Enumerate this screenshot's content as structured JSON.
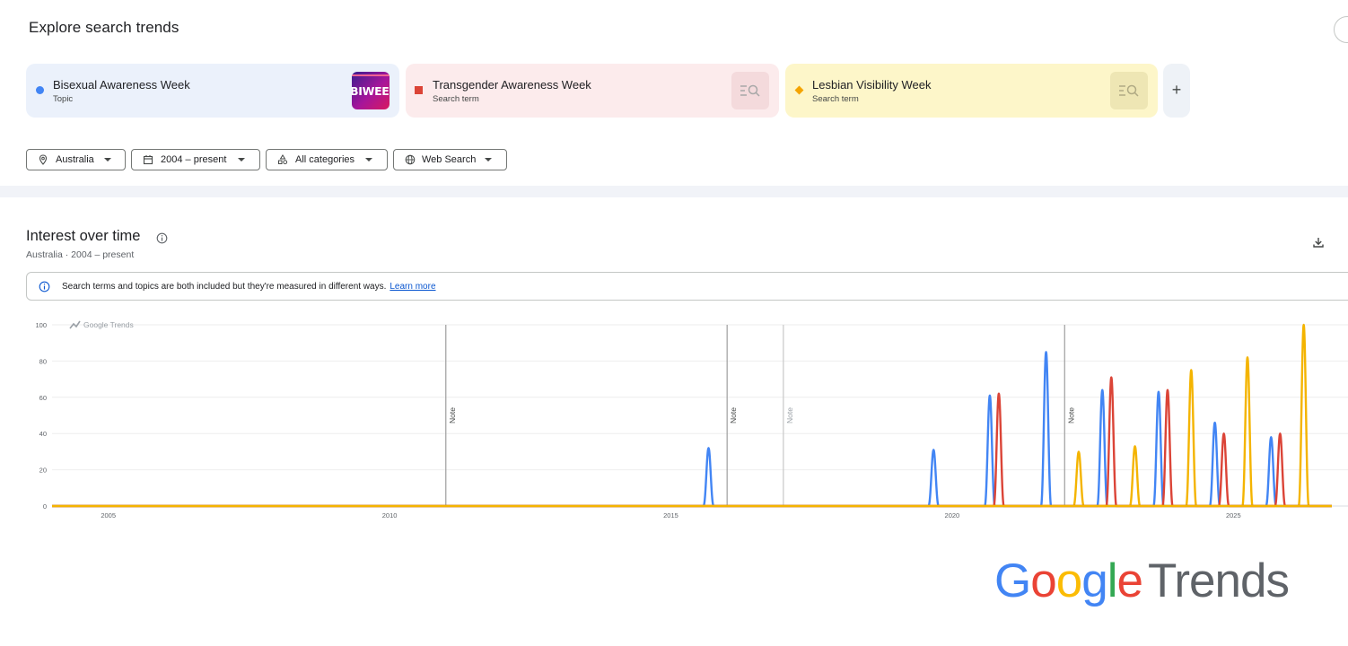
{
  "page": {
    "title": "Explore search trends"
  },
  "terms": [
    {
      "name": "Bisexual Awareness Week",
      "type": "Topic",
      "color": "#4285f4",
      "marker": "circle",
      "thumb_text": "BIWEEK"
    },
    {
      "name": "Transgender Awareness Week",
      "type": "Search term",
      "color": "#db4437",
      "marker": "square",
      "icon": "search-list-icon"
    },
    {
      "name": "Lesbian Visibility Week",
      "type": "Search term",
      "color": "#f4b400",
      "marker": "diamond",
      "icon": "search-list-icon"
    }
  ],
  "add_term": {
    "label": "+"
  },
  "filters": {
    "location": "Australia",
    "time_range": "2004 – present",
    "category": "All categories",
    "property": "Web Search"
  },
  "interest_over_time": {
    "title": "Interest over time",
    "subtitle": "Australia · 2004 – present",
    "notice": "Search terms and topics are both included but they're measured in different ways.",
    "notice_link": "Learn more",
    "watermark": "Google Trends"
  },
  "chart_data": {
    "type": "line",
    "x_type": "date",
    "xlim": [
      2004.0,
      2026.75
    ],
    "ylim": [
      0,
      100
    ],
    "yticks": [
      0,
      20,
      40,
      60,
      80,
      100
    ],
    "xticks": [
      2005,
      2010,
      2015,
      2020,
      2025
    ],
    "grid": true,
    "notes": [
      {
        "x": 2011.0,
        "label": "Note",
        "style": "dark"
      },
      {
        "x": 2016.0,
        "label": "Note",
        "style": "dark"
      },
      {
        "x": 2017.0,
        "label": "Note",
        "style": "light"
      },
      {
        "x": 2022.0,
        "label": "Note",
        "style": "dark"
      }
    ],
    "series": [
      {
        "name": "Bisexual Awareness Week",
        "color": "#4285f4",
        "peaks": [
          [
            2015.67,
            32
          ],
          [
            2019.67,
            31
          ],
          [
            2020.67,
            61
          ],
          [
            2021.67,
            85
          ],
          [
            2022.67,
            64
          ],
          [
            2023.67,
            63
          ],
          [
            2024.67,
            46
          ],
          [
            2025.67,
            38
          ]
        ]
      },
      {
        "name": "Transgender Awareness Week",
        "color": "#db4437",
        "peaks": [
          [
            2020.83,
            62
          ],
          [
            2022.83,
            71
          ],
          [
            2023.83,
            64
          ],
          [
            2024.83,
            40
          ],
          [
            2025.83,
            40
          ]
        ]
      },
      {
        "name": "Lesbian Visibility Week",
        "color": "#f4b400",
        "peaks": [
          [
            2022.25,
            30
          ],
          [
            2023.25,
            33
          ],
          [
            2024.25,
            75
          ],
          [
            2025.25,
            82
          ],
          [
            2026.25,
            100
          ]
        ]
      }
    ]
  },
  "brand": {
    "letters": [
      {
        "char": "G",
        "cls": "gb"
      },
      {
        "char": "o",
        "cls": "gr"
      },
      {
        "char": "o",
        "cls": "gy"
      },
      {
        "char": "g",
        "cls": "gb"
      },
      {
        "char": "l",
        "cls": "gg"
      },
      {
        "char": "e",
        "cls": "gr"
      }
    ],
    "suffix": "Trends"
  }
}
